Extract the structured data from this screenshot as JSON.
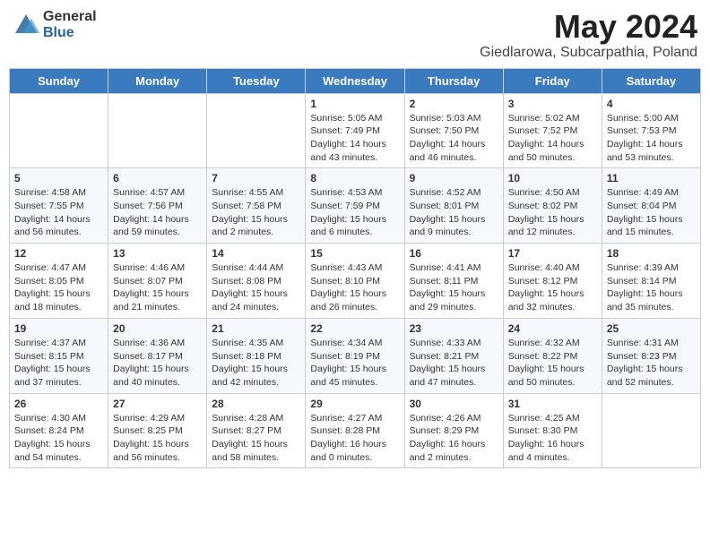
{
  "logo": {
    "general": "General",
    "blue": "Blue"
  },
  "title": {
    "month": "May 2024",
    "location": "Giedlarowa, Subcarpathia, Poland"
  },
  "weekdays": [
    "Sunday",
    "Monday",
    "Tuesday",
    "Wednesday",
    "Thursday",
    "Friday",
    "Saturday"
  ],
  "weeks": [
    [
      {
        "day": "",
        "info": ""
      },
      {
        "day": "",
        "info": ""
      },
      {
        "day": "",
        "info": ""
      },
      {
        "day": "1",
        "info": "Sunrise: 5:05 AM\nSunset: 7:49 PM\nDaylight: 14 hours\nand 43 minutes."
      },
      {
        "day": "2",
        "info": "Sunrise: 5:03 AM\nSunset: 7:50 PM\nDaylight: 14 hours\nand 46 minutes."
      },
      {
        "day": "3",
        "info": "Sunrise: 5:02 AM\nSunset: 7:52 PM\nDaylight: 14 hours\nand 50 minutes."
      },
      {
        "day": "4",
        "info": "Sunrise: 5:00 AM\nSunset: 7:53 PM\nDaylight: 14 hours\nand 53 minutes."
      }
    ],
    [
      {
        "day": "5",
        "info": "Sunrise: 4:58 AM\nSunset: 7:55 PM\nDaylight: 14 hours\nand 56 minutes."
      },
      {
        "day": "6",
        "info": "Sunrise: 4:57 AM\nSunset: 7:56 PM\nDaylight: 14 hours\nand 59 minutes."
      },
      {
        "day": "7",
        "info": "Sunrise: 4:55 AM\nSunset: 7:58 PM\nDaylight: 15 hours\nand 2 minutes."
      },
      {
        "day": "8",
        "info": "Sunrise: 4:53 AM\nSunset: 7:59 PM\nDaylight: 15 hours\nand 6 minutes."
      },
      {
        "day": "9",
        "info": "Sunrise: 4:52 AM\nSunset: 8:01 PM\nDaylight: 15 hours\nand 9 minutes."
      },
      {
        "day": "10",
        "info": "Sunrise: 4:50 AM\nSunset: 8:02 PM\nDaylight: 15 hours\nand 12 minutes."
      },
      {
        "day": "11",
        "info": "Sunrise: 4:49 AM\nSunset: 8:04 PM\nDaylight: 15 hours\nand 15 minutes."
      }
    ],
    [
      {
        "day": "12",
        "info": "Sunrise: 4:47 AM\nSunset: 8:05 PM\nDaylight: 15 hours\nand 18 minutes."
      },
      {
        "day": "13",
        "info": "Sunrise: 4:46 AM\nSunset: 8:07 PM\nDaylight: 15 hours\nand 21 minutes."
      },
      {
        "day": "14",
        "info": "Sunrise: 4:44 AM\nSunset: 8:08 PM\nDaylight: 15 hours\nand 24 minutes."
      },
      {
        "day": "15",
        "info": "Sunrise: 4:43 AM\nSunset: 8:10 PM\nDaylight: 15 hours\nand 26 minutes."
      },
      {
        "day": "16",
        "info": "Sunrise: 4:41 AM\nSunset: 8:11 PM\nDaylight: 15 hours\nand 29 minutes."
      },
      {
        "day": "17",
        "info": "Sunrise: 4:40 AM\nSunset: 8:12 PM\nDaylight: 15 hours\nand 32 minutes."
      },
      {
        "day": "18",
        "info": "Sunrise: 4:39 AM\nSunset: 8:14 PM\nDaylight: 15 hours\nand 35 minutes."
      }
    ],
    [
      {
        "day": "19",
        "info": "Sunrise: 4:37 AM\nSunset: 8:15 PM\nDaylight: 15 hours\nand 37 minutes."
      },
      {
        "day": "20",
        "info": "Sunrise: 4:36 AM\nSunset: 8:17 PM\nDaylight: 15 hours\nand 40 minutes."
      },
      {
        "day": "21",
        "info": "Sunrise: 4:35 AM\nSunset: 8:18 PM\nDaylight: 15 hours\nand 42 minutes."
      },
      {
        "day": "22",
        "info": "Sunrise: 4:34 AM\nSunset: 8:19 PM\nDaylight: 15 hours\nand 45 minutes."
      },
      {
        "day": "23",
        "info": "Sunrise: 4:33 AM\nSunset: 8:21 PM\nDaylight: 15 hours\nand 47 minutes."
      },
      {
        "day": "24",
        "info": "Sunrise: 4:32 AM\nSunset: 8:22 PM\nDaylight: 15 hours\nand 50 minutes."
      },
      {
        "day": "25",
        "info": "Sunrise: 4:31 AM\nSunset: 8:23 PM\nDaylight: 15 hours\nand 52 minutes."
      }
    ],
    [
      {
        "day": "26",
        "info": "Sunrise: 4:30 AM\nSunset: 8:24 PM\nDaylight: 15 hours\nand 54 minutes."
      },
      {
        "day": "27",
        "info": "Sunrise: 4:29 AM\nSunset: 8:25 PM\nDaylight: 15 hours\nand 56 minutes."
      },
      {
        "day": "28",
        "info": "Sunrise: 4:28 AM\nSunset: 8:27 PM\nDaylight: 15 hours\nand 58 minutes."
      },
      {
        "day": "29",
        "info": "Sunrise: 4:27 AM\nSunset: 8:28 PM\nDaylight: 16 hours\nand 0 minutes."
      },
      {
        "day": "30",
        "info": "Sunrise: 4:26 AM\nSunset: 8:29 PM\nDaylight: 16 hours\nand 2 minutes."
      },
      {
        "day": "31",
        "info": "Sunrise: 4:25 AM\nSunset: 8:30 PM\nDaylight: 16 hours\nand 4 minutes."
      },
      {
        "day": "",
        "info": ""
      }
    ]
  ]
}
